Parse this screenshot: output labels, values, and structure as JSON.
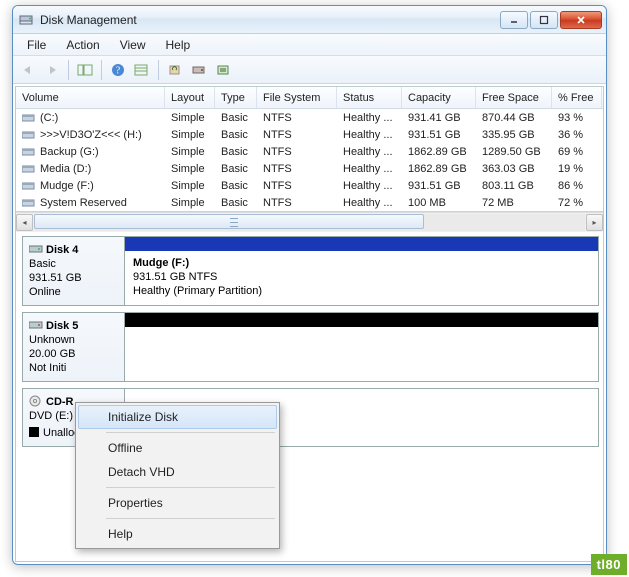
{
  "window": {
    "title": "Disk Management"
  },
  "menu": {
    "file": "File",
    "action": "Action",
    "view": "View",
    "help": "Help"
  },
  "columns": {
    "volume": "Volume",
    "layout": "Layout",
    "type": "Type",
    "fs": "File System",
    "status": "Status",
    "capacity": "Capacity",
    "free": "Free Space",
    "pct": "% Free"
  },
  "volumes": [
    {
      "name": "(C:)",
      "layout": "Simple",
      "type": "Basic",
      "fs": "NTFS",
      "status": "Healthy ...",
      "cap": "931.41 GB",
      "free": "870.44 GB",
      "pct": "93 %"
    },
    {
      "name": ">>>V!D3O'Z<<< (H:)",
      "layout": "Simple",
      "type": "Basic",
      "fs": "NTFS",
      "status": "Healthy ...",
      "cap": "931.51 GB",
      "free": "335.95 GB",
      "pct": "36 %"
    },
    {
      "name": "Backup  (G:)",
      "layout": "Simple",
      "type": "Basic",
      "fs": "NTFS",
      "status": "Healthy ...",
      "cap": "1862.89 GB",
      "free": "1289.50 GB",
      "pct": "69 %"
    },
    {
      "name": "Media (D:)",
      "layout": "Simple",
      "type": "Basic",
      "fs": "NTFS",
      "status": "Healthy ...",
      "cap": "1862.89 GB",
      "free": "363.03 GB",
      "pct": "19 %"
    },
    {
      "name": "Mudge (F:)",
      "layout": "Simple",
      "type": "Basic",
      "fs": "NTFS",
      "status": "Healthy ...",
      "cap": "931.51 GB",
      "free": "803.11 GB",
      "pct": "86 %"
    },
    {
      "name": "System Reserved",
      "layout": "Simple",
      "type": "Basic",
      "fs": "NTFS",
      "status": "Healthy ...",
      "cap": "100 MB",
      "free": "72 MB",
      "pct": "72 %"
    }
  ],
  "disk4": {
    "name": "Disk 4",
    "type": "Basic",
    "size": "931.51 GB",
    "state": "Online",
    "part_name": "Mudge  (F:)",
    "part_detail": "931.51 GB NTFS",
    "part_status": "Healthy (Primary Partition)"
  },
  "disk5": {
    "name": "Disk 5",
    "type": "Unknown",
    "size": "20.00 GB",
    "state": "Not Initi"
  },
  "cd": {
    "name": "CD-R",
    "detail": "DVD (E:)",
    "unalloc": "Unalloc"
  },
  "context": {
    "init": "Initialize Disk",
    "offline": "Offline",
    "detach": "Detach VHD",
    "props": "Properties",
    "help": "Help"
  },
  "watermark": "tl80"
}
